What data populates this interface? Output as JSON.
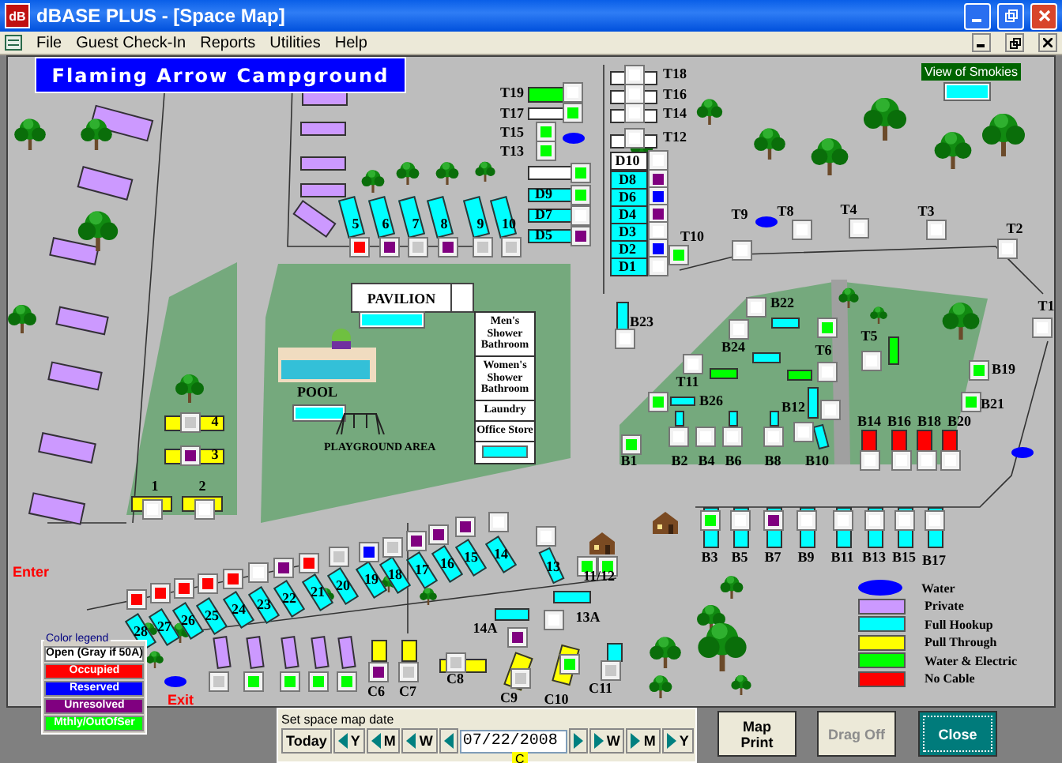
{
  "window": {
    "icon_text": "dB",
    "title": "dBASE PLUS - [Space Map]"
  },
  "menu": [
    "File",
    "Guest Check-In",
    "Reports",
    "Utilities",
    "Help"
  ],
  "map": {
    "banner": "Flaming Arrow Campground",
    "view_label": "View of Smokies",
    "site_rows": [
      [
        {
          "label": "T19",
          "kind": "water_electric",
          "color": "#ffffff"
        },
        {
          "label": "T17",
          "kind": "standard",
          "color": "#00ff00"
        },
        {
          "label": "T15",
          "kind": "box_only",
          "color": "#00ff00"
        },
        {
          "label": "T13",
          "kind": "box_only",
          "color": "#00ff00"
        },
        {
          "kind": "standard",
          "color": "#00ff00"
        },
        {
          "label": "D9",
          "kind": "full_hookup",
          "color": "#00ff00"
        },
        {
          "label": "D7",
          "kind": "full_hookup",
          "color": "#ffffff"
        },
        {
          "label": "D5",
          "kind": "full_hookup",
          "color": "#800080"
        }
      ],
      [
        {
          "label": "T18",
          "kind": "standard",
          "color": "#ffffff"
        },
        {
          "label": "T16",
          "kind": "standard",
          "color": "#ffffff"
        },
        {
          "label": "T14",
          "kind": "standard",
          "color": "#ffffff"
        },
        {
          "label": "T12",
          "kind": "standard",
          "color": "#ffffff"
        },
        {
          "label": "D10",
          "kind": "standard",
          "color": "#ffffff"
        },
        {
          "label": "D8",
          "kind": "full_hookup",
          "color": "#800080"
        },
        {
          "label": "D6",
          "kind": "full_hookup",
          "color": "#0000ff"
        },
        {
          "label": "D4",
          "kind": "full_hookup",
          "color": "#800080"
        },
        {
          "label": "D3",
          "kind": "full_hookup",
          "color": "#ffffff"
        },
        {
          "label": "D2",
          "kind": "full_hookup",
          "color": "#0000ff"
        },
        {
          "label": "D1",
          "kind": "full_hookup",
          "color": "#ffffff"
        }
      ],
      [
        {
          "label": "5",
          "kind": "full_hookup",
          "color": "#ff0000"
        },
        {
          "label": "6",
          "kind": "full_hookup",
          "color": "#800080"
        },
        {
          "label": "7",
          "kind": "full_hookup",
          "color": "#c8c8c8"
        },
        {
          "label": "8",
          "kind": "full_hookup",
          "color": "#800080"
        },
        {
          "label": "9",
          "kind": "full_hookup",
          "color": "#c8c8c8"
        },
        {
          "label": "10",
          "kind": "full_hookup",
          "color": "#c8c8c8"
        }
      ],
      [
        {
          "label": "T10",
          "kind": "box_only",
          "color": "#00ff00"
        },
        {
          "label": "T9",
          "kind": "box_only",
          "color": "#ffffff"
        },
        {
          "label": "T8",
          "kind": "box_only",
          "color": "#ffffff"
        },
        {
          "label": "T4",
          "kind": "box_only",
          "color": "#ffffff"
        },
        {
          "label": "T3",
          "kind": "box_only",
          "color": "#ffffff"
        },
        {
          "label": "T2",
          "kind": "box_only",
          "color": "#ffffff"
        },
        {
          "label": "T1",
          "kind": "box_only",
          "color": "#ffffff"
        }
      ],
      [
        {
          "label": "B23",
          "kind": "full_hookup",
          "color": "#ffffff"
        },
        {
          "label": "B22",
          "kind": "full_hookup",
          "color": "#ffffff"
        },
        {
          "kind": "box_only",
          "color": "#00ff00"
        },
        {
          "label": "B24",
          "kind": "full_hookup",
          "color": "#ffffff"
        },
        {
          "label": "T5",
          "kind": "water_electric",
          "color": "#ffffff"
        },
        {
          "label": "T6",
          "kind": "water_electric",
          "color": "#ffffff"
        },
        {
          "label": "B19",
          "kind": "box_only",
          "color": "#00ff00"
        },
        {
          "label": "T11",
          "kind": "water_electric",
          "color": "#ffffff"
        },
        {
          "label": "B26",
          "kind": "full_hookup",
          "color": "#00ff00"
        },
        {
          "label": "B12",
          "kind": "full_hookup",
          "color": "#ffffff"
        },
        {
          "label": "B21",
          "kind": "box_only",
          "color": "#00ff00"
        }
      ],
      [
        {
          "label": "B1",
          "kind": "box_only",
          "color": "#00ff00"
        },
        {
          "label": "B2",
          "kind": "full_hookup",
          "color": "#ffffff"
        },
        {
          "label": "B4",
          "kind": "box_only",
          "color": "#ffffff"
        },
        {
          "label": "B6",
          "kind": "full_hookup",
          "color": "#ffffff"
        },
        {
          "label": "B8",
          "kind": "full_hookup",
          "color": "#ffffff"
        },
        {
          "label": "B10",
          "kind": "full_hookup",
          "color": "#ffffff"
        }
      ],
      [
        {
          "label": "B14",
          "kind": "no_cable",
          "color": "#ffffff"
        },
        {
          "label": "B16",
          "kind": "no_cable",
          "color": "#ffffff"
        },
        {
          "label": "B18",
          "kind": "no_cable",
          "color": "#ffffff"
        },
        {
          "label": "B20",
          "kind": "no_cable",
          "color": "#ffffff"
        }
      ],
      [
        {
          "label": "B3",
          "kind": "full_hookup",
          "color": "#00ff00"
        },
        {
          "label": "B5",
          "kind": "full_hookup",
          "color": "#ffffff"
        },
        {
          "label": "B7",
          "kind": "full_hookup",
          "color": "#800080"
        },
        {
          "label": "B9",
          "kind": "full_hookup",
          "color": "#ffffff"
        },
        {
          "label": "B11",
          "kind": "full_hookup",
          "color": "#ffffff"
        },
        {
          "label": "B13",
          "kind": "full_hookup",
          "color": "#ffffff"
        },
        {
          "label": "B15",
          "kind": "full_hookup",
          "color": "#ffffff"
        },
        {
          "label": "B17",
          "kind": "full_hookup",
          "color": "#ffffff"
        }
      ],
      [
        {
          "label": "4",
          "kind": "pull_through",
          "color": "#c8c8c8"
        },
        {
          "label": "3",
          "kind": "pull_through",
          "color": "#800080"
        },
        {
          "label": "1",
          "kind": "pull_through",
          "color": "#ffffff"
        },
        {
          "label": "2",
          "kind": "pull_through",
          "color": "#ffffff"
        }
      ],
      [
        {
          "label": "28",
          "kind": "full_hookup",
          "color": "#ff0000"
        },
        {
          "label": "27",
          "kind": "full_hookup",
          "color": "#ff0000"
        },
        {
          "label": "26",
          "kind": "full_hookup",
          "color": "#ff0000"
        },
        {
          "label": "25",
          "kind": "full_hookup",
          "color": "#ff0000"
        },
        {
          "label": "24",
          "kind": "full_hookup",
          "color": "#ff0000"
        },
        {
          "label": "23",
          "kind": "full_hookup",
          "color": "#ffffff"
        },
        {
          "label": "22",
          "kind": "full_hookup",
          "color": "#800080"
        },
        {
          "label": "21",
          "kind": "full_hookup",
          "color": "#ff0000"
        },
        {
          "label": "20",
          "kind": "full_hookup",
          "color": "#c8c8c8"
        },
        {
          "label": "19",
          "kind": "full_hookup",
          "color": "#0000ff"
        },
        {
          "label": "18",
          "kind": "full_hookup",
          "color": "#c8c8c8"
        },
        {
          "label": "17",
          "kind": "full_hookup",
          "color": "#800080"
        },
        {
          "label": "16",
          "kind": "full_hookup",
          "color": "#800080"
        },
        {
          "label": "15",
          "kind": "full_hookup",
          "color": "#800080"
        },
        {
          "label": "14",
          "kind": "full_hookup",
          "color": "#ffffff"
        },
        {
          "label": "13",
          "kind": "full_hookup",
          "color": "#ffffff"
        },
        {
          "label": "11/12",
          "kind": "double",
          "color": "#00ff00"
        },
        {
          "label": "14A",
          "kind": "full_hookup",
          "color": "#800080"
        },
        {
          "label": "13A",
          "kind": "full_hookup",
          "color": "#ffffff"
        }
      ],
      [
        {
          "kind": "private",
          "color": "#c8c8c8"
        },
        {
          "kind": "private",
          "color": "#00ff00"
        },
        {
          "kind": "private",
          "color": "#00ff00"
        },
        {
          "kind": "private",
          "color": "#00ff00"
        },
        {
          "kind": "private",
          "color": "#00ff00"
        },
        {
          "label": "C6",
          "kind": "pull_through",
          "color": "#800080"
        },
        {
          "label": "C7",
          "kind": "pull_through",
          "color": "#c8c8c8"
        },
        {
          "label": "C8",
          "kind": "pull_through",
          "color": "#c8c8c8"
        },
        {
          "label": "C9",
          "kind": "pull_through",
          "color": "#c8c8c8"
        },
        {
          "label": "C10",
          "kind": "pull_through",
          "color": "#00ff00"
        },
        {
          "label": "C11",
          "kind": "full_hookup",
          "color": "#c8c8c8"
        }
      ]
    ],
    "pavilion": "PAVILION",
    "pool": "POOL",
    "playground": "PLAYGROUND AREA",
    "buildings": [
      "Men's Shower Bathroom",
      "Women's Shower Bathroom",
      "Laundry",
      "Office Store"
    ],
    "enter_label": "Enter",
    "exit_label": "Exit",
    "color_legend": {
      "title": "Color legend",
      "items": [
        {
          "label": "Open (Gray if 50A)",
          "color": "#ffffff"
        },
        {
          "label": "Occupied",
          "color": "#ff0000"
        },
        {
          "label": "Reserved",
          "color": "#0000ff"
        },
        {
          "label": "Unresolved",
          "color": "#800080"
        },
        {
          "label": "Mthly/OutOfSer",
          "color": "#00ff00"
        }
      ]
    },
    "site_legend": [
      {
        "label": "Water",
        "kind": "oval",
        "color": "#0000ff"
      },
      {
        "label": "Private",
        "kind": "swatch",
        "color": "#cc99ff"
      },
      {
        "label": "Full Hookup",
        "kind": "swatch",
        "color": "#00ffff"
      },
      {
        "label": "Pull Through",
        "kind": "swatch",
        "color": "#ffff00"
      },
      {
        "label": "Water & Electric",
        "kind": "swatch",
        "color": "#00ff00"
      },
      {
        "label": "No Cable",
        "kind": "swatch",
        "color": "#ff0000"
      }
    ]
  },
  "date_panel": {
    "label": "Set space map date",
    "today": "Today",
    "back": [
      "Y",
      "M",
      "W"
    ],
    "date": "07/22/2008",
    "forward": [
      "W",
      "M",
      "Y"
    ],
    "flag": "C"
  },
  "buttons": [
    {
      "label": "Map Print",
      "disabled": false,
      "default": false
    },
    {
      "label": "Drag Off",
      "disabled": true,
      "default": false
    },
    {
      "label": "Close",
      "disabled": false,
      "default": true
    }
  ]
}
